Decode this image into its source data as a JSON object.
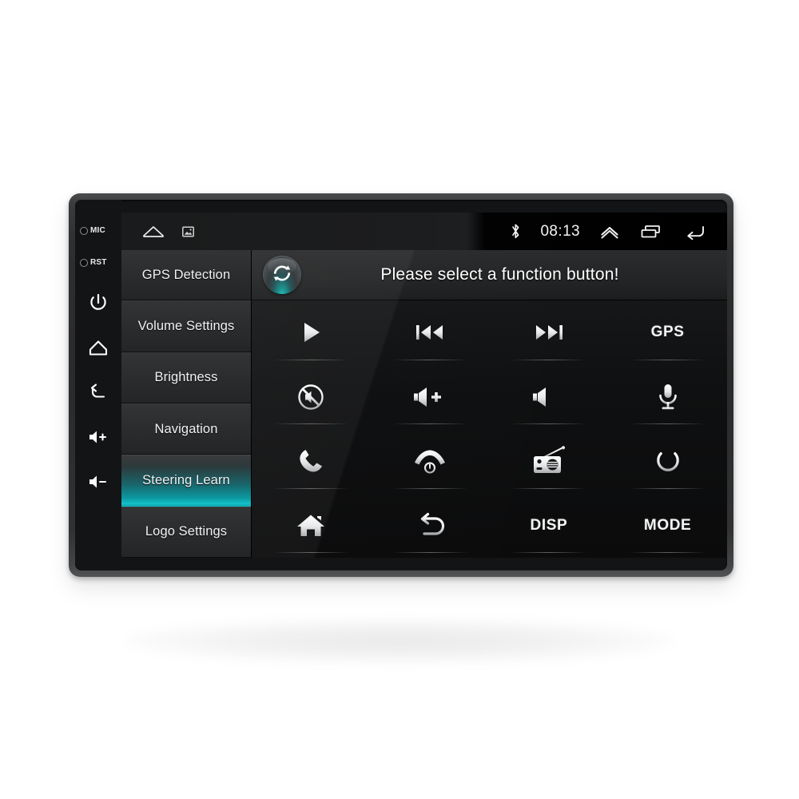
{
  "device": {
    "bezel_controls": [
      {
        "name": "mic-hole",
        "label": "MIC",
        "type": "hole"
      },
      {
        "name": "reset-hole",
        "label": "RST",
        "type": "hole"
      },
      {
        "name": "power-button",
        "label": "Power",
        "icon": "power-icon"
      },
      {
        "name": "home-button",
        "label": "Home",
        "icon": "home-icon"
      },
      {
        "name": "back-button",
        "label": "Back",
        "icon": "back-arrow-icon"
      },
      {
        "name": "volume-up-button",
        "label": "Volume Up",
        "icon": "volume-up-icon"
      },
      {
        "name": "volume-down-button",
        "label": "Volume Down",
        "icon": "volume-down-icon"
      }
    ]
  },
  "statusbar": {
    "left_icons": [
      {
        "name": "home-outline-icon",
        "label": "Home"
      },
      {
        "name": "screenshot-icon",
        "label": "Screenshot"
      }
    ],
    "bluetooth_icon": "bluetooth-icon",
    "clock": "08:13",
    "right_icons": [
      {
        "name": "chevron-up-icon",
        "label": "Expand"
      },
      {
        "name": "recents-icon",
        "label": "Recent apps"
      },
      {
        "name": "back-icon",
        "label": "Back"
      }
    ]
  },
  "sidebar": {
    "items": [
      {
        "label": "GPS Detection",
        "selected": false
      },
      {
        "label": "Volume Settings",
        "selected": false
      },
      {
        "label": "Brightness",
        "selected": false
      },
      {
        "label": "Navigation",
        "selected": false
      },
      {
        "label": "Steering Learn",
        "selected": true
      },
      {
        "label": "Logo Settings",
        "selected": false
      }
    ],
    "selected_index": 4,
    "highlight_color": "#0b9aa2"
  },
  "header": {
    "refresh_icon": "refresh-cycle-icon",
    "title": "Please select a function button!"
  },
  "function_grid": {
    "rows": 4,
    "columns": 4,
    "buttons": [
      {
        "name": "play-button",
        "icon": "play-icon",
        "label": ""
      },
      {
        "name": "previous-button",
        "icon": "previous-track-icon",
        "label": ""
      },
      {
        "name": "next-button",
        "icon": "next-track-icon",
        "label": ""
      },
      {
        "name": "gps-button",
        "icon": "",
        "label": "GPS"
      },
      {
        "name": "mute-button",
        "icon": "mute-icon",
        "label": ""
      },
      {
        "name": "volume-up-button",
        "icon": "volume-up-icon",
        "label": ""
      },
      {
        "name": "volume-down-button",
        "icon": "volume-down-icon",
        "label": ""
      },
      {
        "name": "voice-button",
        "icon": "microphone-icon",
        "label": ""
      },
      {
        "name": "call-answer-button",
        "icon": "phone-icon",
        "label": ""
      },
      {
        "name": "call-end-button",
        "icon": "hang-up-icon",
        "label": ""
      },
      {
        "name": "radio-button",
        "icon": "radio-icon",
        "label": ""
      },
      {
        "name": "power-button",
        "icon": "power-icon",
        "label": ""
      },
      {
        "name": "home-button",
        "icon": "home-filled-icon",
        "label": ""
      },
      {
        "name": "back-button",
        "icon": "return-arrow-icon",
        "label": ""
      },
      {
        "name": "disp-button",
        "icon": "",
        "label": "DISP"
      },
      {
        "name": "mode-button",
        "icon": "",
        "label": "MODE"
      }
    ]
  }
}
